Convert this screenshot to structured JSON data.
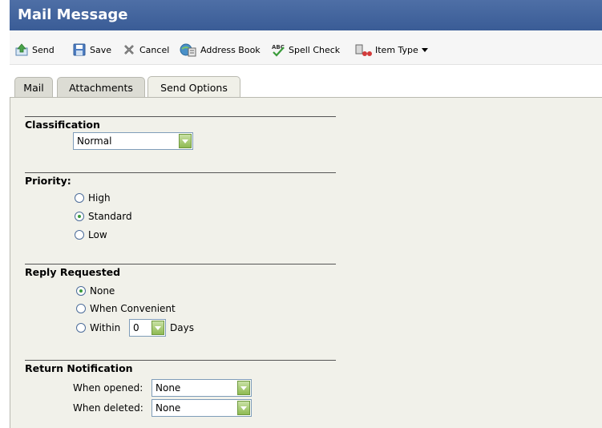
{
  "window": {
    "title": "Mail Message"
  },
  "toolbar": {
    "send": "Send",
    "save": "Save",
    "cancel": "Cancel",
    "address_book": "Address Book",
    "spell_check": "Spell Check",
    "item_type": "Item Type"
  },
  "tabs": [
    "Mail",
    "Attachments",
    "Send Options"
  ],
  "classification": {
    "title": "Classification",
    "value": "Normal"
  },
  "priority": {
    "title": "Priority:",
    "options": [
      "High",
      "Standard",
      "Low"
    ],
    "selected": "Standard"
  },
  "reply": {
    "title": "Reply Requested",
    "none": "None",
    "when_convenient": "When Convenient",
    "within": "Within",
    "days_value": "0",
    "days": "Days",
    "selected": "None"
  },
  "return_notification": {
    "title": "Return Notification",
    "when_opened_label": "When opened:",
    "when_opened_value": "None",
    "when_deleted_label": "When deleted:",
    "when_deleted_value": "None"
  },
  "colors": {
    "title_bar": "#3a5c96",
    "panel": "#f1f1ea",
    "accent_green": "#8fba53"
  }
}
